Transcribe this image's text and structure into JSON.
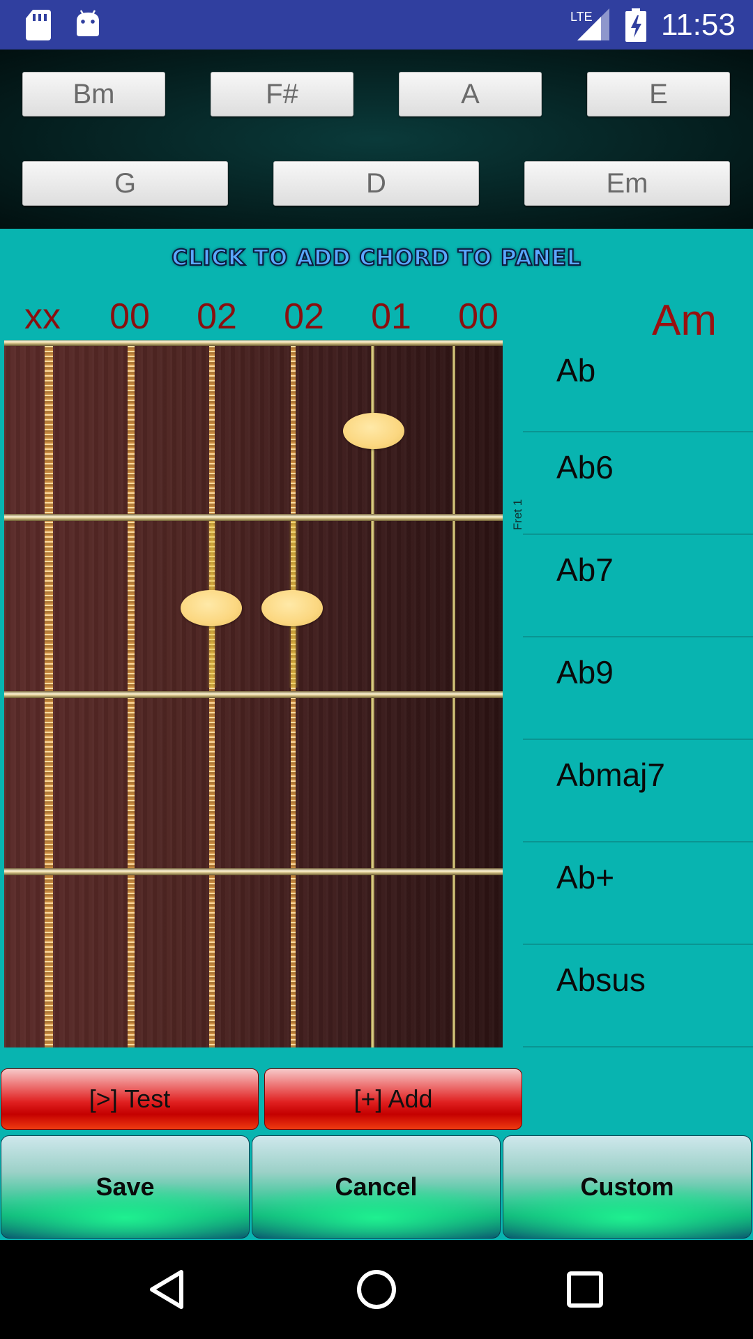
{
  "status_bar": {
    "network_label": "LTE",
    "time": "11:53"
  },
  "chord_panel": {
    "row1": [
      "Bm",
      "F#",
      "A",
      "E"
    ],
    "row2": [
      "G",
      "D",
      "Em"
    ]
  },
  "editor": {
    "hint": "CLICK TO ADD CHORD TO PANEL",
    "string_markers": [
      "xx",
      "00",
      "02",
      "02",
      "01",
      "00"
    ],
    "current_chord": "Am",
    "fret_label": "Fret 1",
    "finger_positions": [
      {
        "string": 5,
        "fret": 1
      },
      {
        "string": 3,
        "fret": 2
      },
      {
        "string": 4,
        "fret": 2
      }
    ]
  },
  "chord_list": [
    "Ab",
    "Ab6",
    "Ab7",
    "Ab9",
    "Abmaj7",
    "Ab+",
    "Absus"
  ],
  "actions": {
    "test_label": "[>] Test",
    "add_label": "[+] Add"
  },
  "footer": {
    "save_label": "Save",
    "cancel_label": "Cancel",
    "custom_label": "Custom"
  },
  "nav": {
    "icons": [
      "back-icon",
      "home-icon",
      "recents-icon"
    ]
  },
  "colors": {
    "status_bar": "#303f9f",
    "main_background": "#08b4b0",
    "marker_text": "#8a0f0f",
    "chord_name": "#9a1010"
  }
}
